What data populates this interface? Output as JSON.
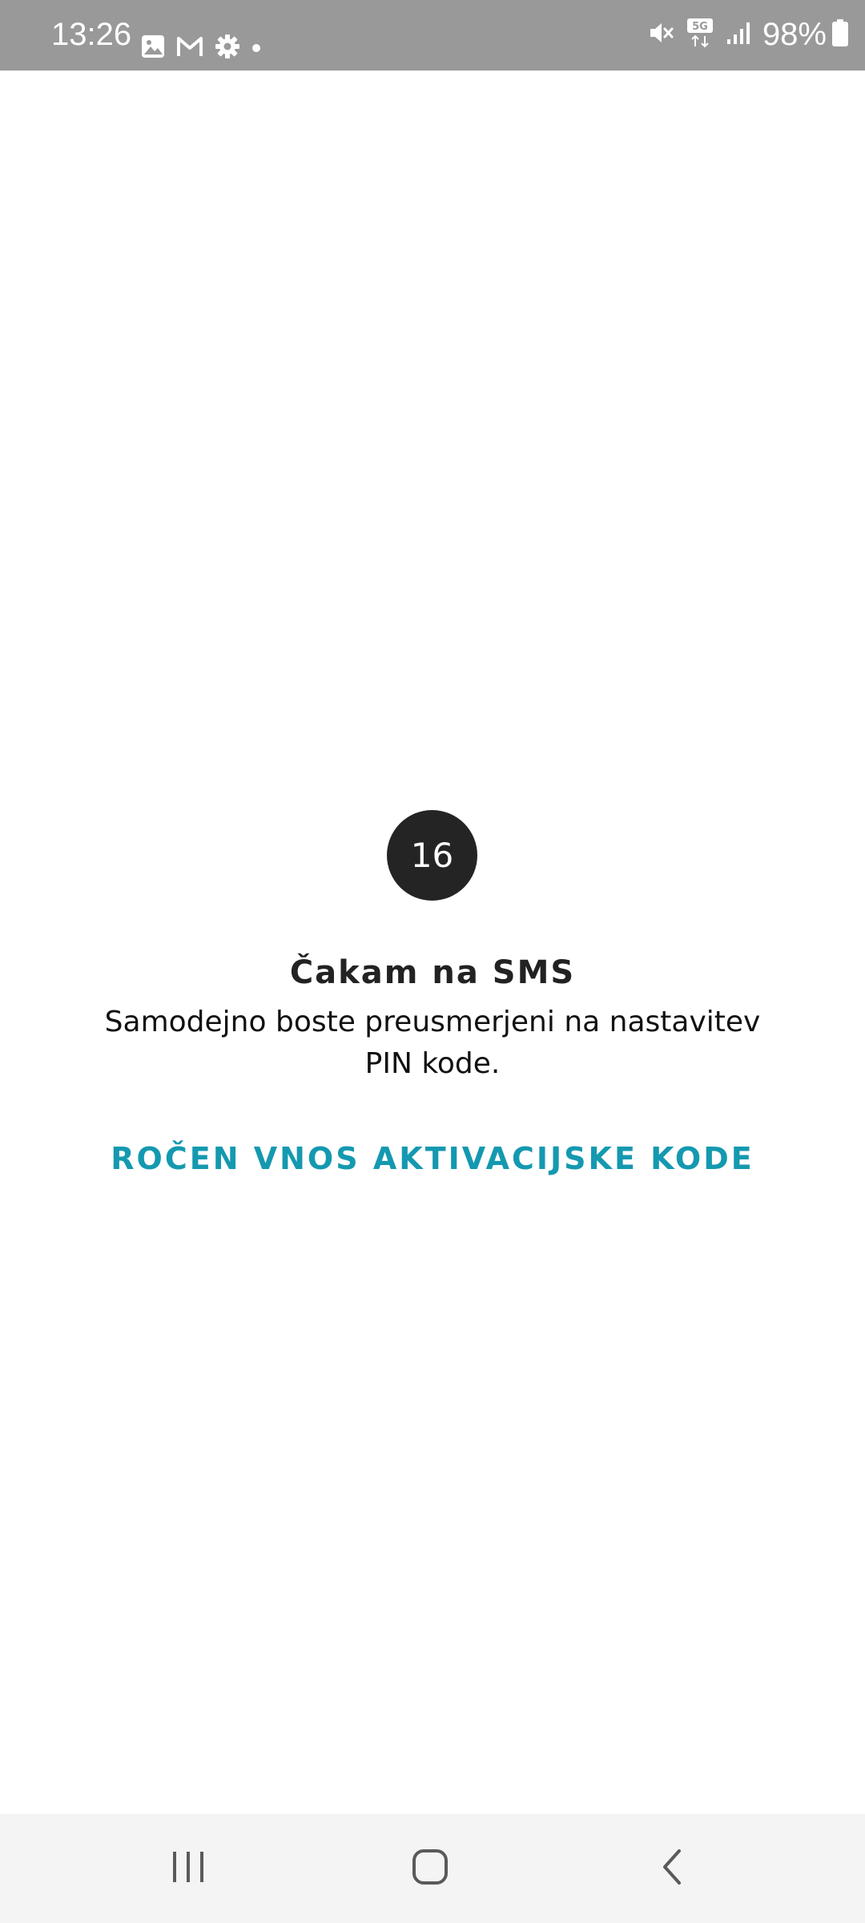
{
  "status_bar": {
    "time": "13:26",
    "battery_percent": "98%",
    "left_icons": [
      "gallery-icon",
      "gmail-icon",
      "settings-icon",
      "dot-icon"
    ],
    "right_icons": [
      "mute-icon",
      "5g-icon",
      "signal-icon",
      "battery-icon"
    ],
    "network_label": "5G"
  },
  "main": {
    "countdown": "16",
    "title": "Čakam na SMS",
    "description": "Samodejno boste preusmerjeni na nastavitev PIN kode.",
    "manual_entry_link": "ROČEN VNOS AKTIVACIJSKE KODE"
  },
  "navigation": {
    "buttons": [
      "recent-apps-icon",
      "home-icon",
      "back-icon"
    ]
  },
  "colors": {
    "status_bar": "#999999",
    "circle": "#242424",
    "link": "#1499b0",
    "nav_bar": "#f4f4f4"
  }
}
